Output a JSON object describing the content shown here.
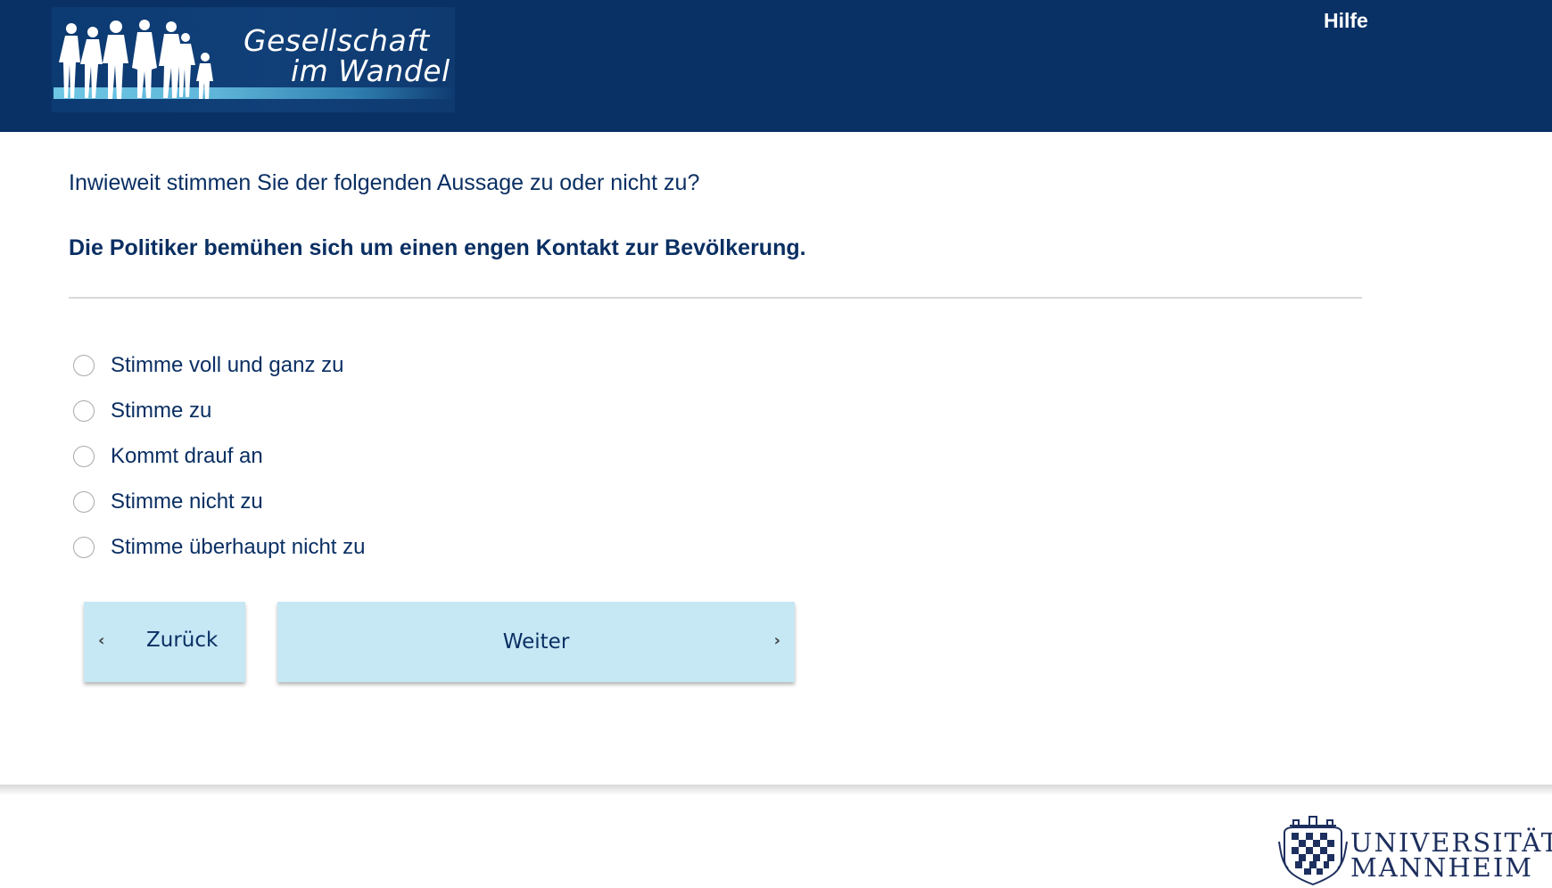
{
  "header": {
    "logo_line1": "Gesellschaft",
    "logo_line2": "im Wandel",
    "help_label": "Hilfe",
    "background_color": "#0a3166"
  },
  "question": {
    "intro": "Inwieweit stimmen Sie der folgenden Aussage zu oder nicht zu?",
    "statement": "Die Politiker bemühen sich um einen engen Kontakt zur Bevölkerung."
  },
  "options": [
    {
      "label": "Stimme voll und ganz zu",
      "selected": false
    },
    {
      "label": "Stimme zu",
      "selected": false
    },
    {
      "label": "Kommt drauf an",
      "selected": false
    },
    {
      "label": "Stimme nicht zu",
      "selected": false
    },
    {
      "label": "Stimme überhaupt nicht zu",
      "selected": false
    }
  ],
  "navigation": {
    "back_label": "Zurück",
    "next_label": "Weiter",
    "back_icon": "chevron-left-icon",
    "next_icon": "chevron-right-icon",
    "button_color": "#c6e7f4"
  },
  "footer": {
    "university_line1": "UNIVERSITÄT",
    "university_line2": "MANNHEIM"
  }
}
